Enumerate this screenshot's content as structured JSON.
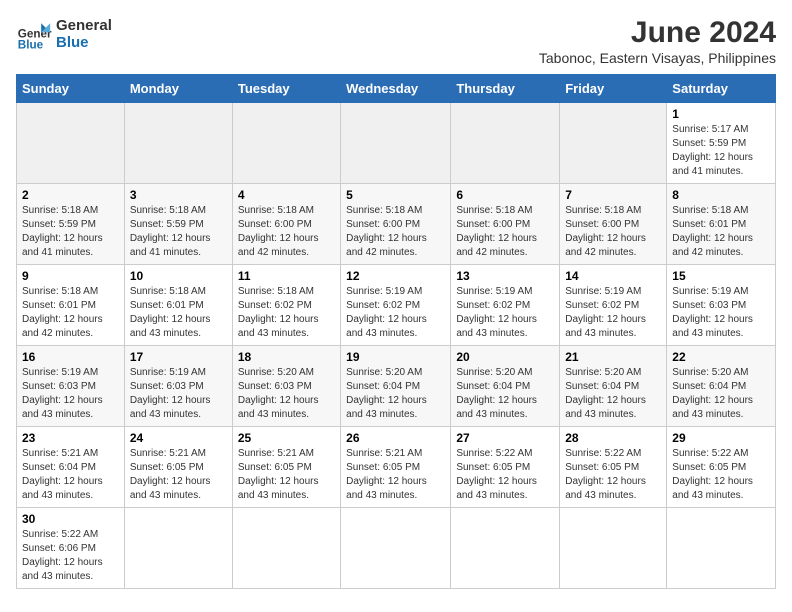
{
  "logo": {
    "text_general": "General",
    "text_blue": "Blue"
  },
  "header": {
    "title": "June 2024",
    "subtitle": "Tabonoc, Eastern Visayas, Philippines"
  },
  "weekdays": [
    "Sunday",
    "Monday",
    "Tuesday",
    "Wednesday",
    "Thursday",
    "Friday",
    "Saturday"
  ],
  "weeks": [
    [
      {
        "day": "",
        "info": ""
      },
      {
        "day": "",
        "info": ""
      },
      {
        "day": "",
        "info": ""
      },
      {
        "day": "",
        "info": ""
      },
      {
        "day": "",
        "info": ""
      },
      {
        "day": "",
        "info": ""
      },
      {
        "day": "1",
        "info": "Sunrise: 5:17 AM\nSunset: 5:59 PM\nDaylight: 12 hours and 41 minutes."
      }
    ],
    [
      {
        "day": "2",
        "info": "Sunrise: 5:18 AM\nSunset: 5:59 PM\nDaylight: 12 hours and 41 minutes."
      },
      {
        "day": "3",
        "info": "Sunrise: 5:18 AM\nSunset: 5:59 PM\nDaylight: 12 hours and 41 minutes."
      },
      {
        "day": "4",
        "info": "Sunrise: 5:18 AM\nSunset: 6:00 PM\nDaylight: 12 hours and 42 minutes."
      },
      {
        "day": "5",
        "info": "Sunrise: 5:18 AM\nSunset: 6:00 PM\nDaylight: 12 hours and 42 minutes."
      },
      {
        "day": "6",
        "info": "Sunrise: 5:18 AM\nSunset: 6:00 PM\nDaylight: 12 hours and 42 minutes."
      },
      {
        "day": "7",
        "info": "Sunrise: 5:18 AM\nSunset: 6:00 PM\nDaylight: 12 hours and 42 minutes."
      },
      {
        "day": "8",
        "info": "Sunrise: 5:18 AM\nSunset: 6:01 PM\nDaylight: 12 hours and 42 minutes."
      }
    ],
    [
      {
        "day": "9",
        "info": "Sunrise: 5:18 AM\nSunset: 6:01 PM\nDaylight: 12 hours and 42 minutes."
      },
      {
        "day": "10",
        "info": "Sunrise: 5:18 AM\nSunset: 6:01 PM\nDaylight: 12 hours and 43 minutes."
      },
      {
        "day": "11",
        "info": "Sunrise: 5:18 AM\nSunset: 6:02 PM\nDaylight: 12 hours and 43 minutes."
      },
      {
        "day": "12",
        "info": "Sunrise: 5:19 AM\nSunset: 6:02 PM\nDaylight: 12 hours and 43 minutes."
      },
      {
        "day": "13",
        "info": "Sunrise: 5:19 AM\nSunset: 6:02 PM\nDaylight: 12 hours and 43 minutes."
      },
      {
        "day": "14",
        "info": "Sunrise: 5:19 AM\nSunset: 6:02 PM\nDaylight: 12 hours and 43 minutes."
      },
      {
        "day": "15",
        "info": "Sunrise: 5:19 AM\nSunset: 6:03 PM\nDaylight: 12 hours and 43 minutes."
      }
    ],
    [
      {
        "day": "16",
        "info": "Sunrise: 5:19 AM\nSunset: 6:03 PM\nDaylight: 12 hours and 43 minutes."
      },
      {
        "day": "17",
        "info": "Sunrise: 5:19 AM\nSunset: 6:03 PM\nDaylight: 12 hours and 43 minutes."
      },
      {
        "day": "18",
        "info": "Sunrise: 5:20 AM\nSunset: 6:03 PM\nDaylight: 12 hours and 43 minutes."
      },
      {
        "day": "19",
        "info": "Sunrise: 5:20 AM\nSunset: 6:04 PM\nDaylight: 12 hours and 43 minutes."
      },
      {
        "day": "20",
        "info": "Sunrise: 5:20 AM\nSunset: 6:04 PM\nDaylight: 12 hours and 43 minutes."
      },
      {
        "day": "21",
        "info": "Sunrise: 5:20 AM\nSunset: 6:04 PM\nDaylight: 12 hours and 43 minutes."
      },
      {
        "day": "22",
        "info": "Sunrise: 5:20 AM\nSunset: 6:04 PM\nDaylight: 12 hours and 43 minutes."
      }
    ],
    [
      {
        "day": "23",
        "info": "Sunrise: 5:21 AM\nSunset: 6:04 PM\nDaylight: 12 hours and 43 minutes."
      },
      {
        "day": "24",
        "info": "Sunrise: 5:21 AM\nSunset: 6:05 PM\nDaylight: 12 hours and 43 minutes."
      },
      {
        "day": "25",
        "info": "Sunrise: 5:21 AM\nSunset: 6:05 PM\nDaylight: 12 hours and 43 minutes."
      },
      {
        "day": "26",
        "info": "Sunrise: 5:21 AM\nSunset: 6:05 PM\nDaylight: 12 hours and 43 minutes."
      },
      {
        "day": "27",
        "info": "Sunrise: 5:22 AM\nSunset: 6:05 PM\nDaylight: 12 hours and 43 minutes."
      },
      {
        "day": "28",
        "info": "Sunrise: 5:22 AM\nSunset: 6:05 PM\nDaylight: 12 hours and 43 minutes."
      },
      {
        "day": "29",
        "info": "Sunrise: 5:22 AM\nSunset: 6:05 PM\nDaylight: 12 hours and 43 minutes."
      }
    ],
    [
      {
        "day": "30",
        "info": "Sunrise: 5:22 AM\nSunset: 6:06 PM\nDaylight: 12 hours and 43 minutes."
      },
      {
        "day": "",
        "info": ""
      },
      {
        "day": "",
        "info": ""
      },
      {
        "day": "",
        "info": ""
      },
      {
        "day": "",
        "info": ""
      },
      {
        "day": "",
        "info": ""
      },
      {
        "day": "",
        "info": ""
      }
    ]
  ]
}
